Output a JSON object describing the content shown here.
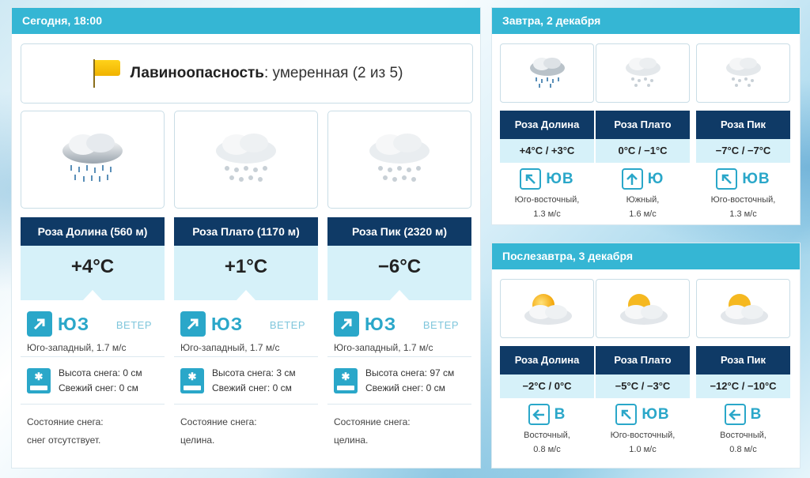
{
  "today": {
    "header": "Сегодня, 18:00",
    "avalanche_label": "Лавиноопасность",
    "avalanche_value": ": умеренная (2 из 5)",
    "wind_label": "ВЕТЕР",
    "snow_height_label": "Высота снега:",
    "fresh_snow_label": "Свежий снег:",
    "snow_state_label": "Состояние снега:",
    "stations": [
      {
        "name": "Роза Долина (560 м)",
        "temp": "+4°C",
        "dir": "ЮЗ",
        "wind_desc": "Юго-западный, 1.7 м/с",
        "snow_height": "0 см",
        "fresh_snow": "0 см",
        "snow_state": "снег отсутствует.",
        "weather_icon": "rain-cloud-icon"
      },
      {
        "name": "Роза Плато (1170 м)",
        "temp": "+1°C",
        "dir": "ЮЗ",
        "wind_desc": "Юго-западный, 1.7 м/с",
        "snow_height": "3 см",
        "fresh_snow": "0 см",
        "snow_state": "целина.",
        "weather_icon": "snow-cloud-icon"
      },
      {
        "name": "Роза Пик (2320 м)",
        "temp": "−6°C",
        "dir": "ЮЗ",
        "wind_desc": "Юго-западный, 1.7 м/с",
        "snow_height": "97 см",
        "fresh_snow": "0 см",
        "snow_state": "целина.",
        "weather_icon": "snow-cloud-icon"
      }
    ]
  },
  "tomorrow": {
    "header": "Завтра, 2 декабря",
    "stations": [
      {
        "name": "Роза Долина",
        "temp": "+4°C / +3°C",
        "dir": "ЮВ",
        "wind_desc": "Юго-восточный,",
        "wind_speed": "1.3 м/с",
        "arrow": "up-left",
        "weather_icon": "rain-cloud-icon"
      },
      {
        "name": "Роза Плато",
        "temp": "0°C / −1°C",
        "dir": "Ю",
        "wind_desc": "Южный,",
        "wind_speed": "1.6 м/с",
        "arrow": "up",
        "weather_icon": "snow-cloud-icon"
      },
      {
        "name": "Роза Пик",
        "temp": "−7°C / −7°C",
        "dir": "ЮВ",
        "wind_desc": "Юго-восточный,",
        "wind_speed": "1.3 м/с",
        "arrow": "up-left",
        "weather_icon": "snow-cloud-icon"
      }
    ]
  },
  "after": {
    "header": "Послезавтра, 3 декабря",
    "stations": [
      {
        "name": "Роза Долина",
        "temp": "−2°C / 0°C",
        "dir": "В",
        "wind_desc": "Восточный,",
        "wind_speed": "0.8 м/с",
        "arrow": "left",
        "weather_icon": "sun-cloud-icon"
      },
      {
        "name": "Роза Плато",
        "temp": "−5°C / −3°C",
        "dir": "ЮВ",
        "wind_desc": "Юго-восточный,",
        "wind_speed": "1.0 м/с",
        "arrow": "up-left",
        "weather_icon": "sun-cloud-icon"
      },
      {
        "name": "Роза Пик",
        "temp": "−12°C / −10°C",
        "dir": "В",
        "wind_desc": "Восточный,",
        "wind_speed": "0.8 м/с",
        "arrow": "left",
        "weather_icon": "sun-cloud-icon"
      }
    ]
  },
  "colors": {
    "accent": "#35b6d4",
    "navy": "#0f3a66",
    "light": "#d6f1f9",
    "flag": "#ffcc00"
  }
}
